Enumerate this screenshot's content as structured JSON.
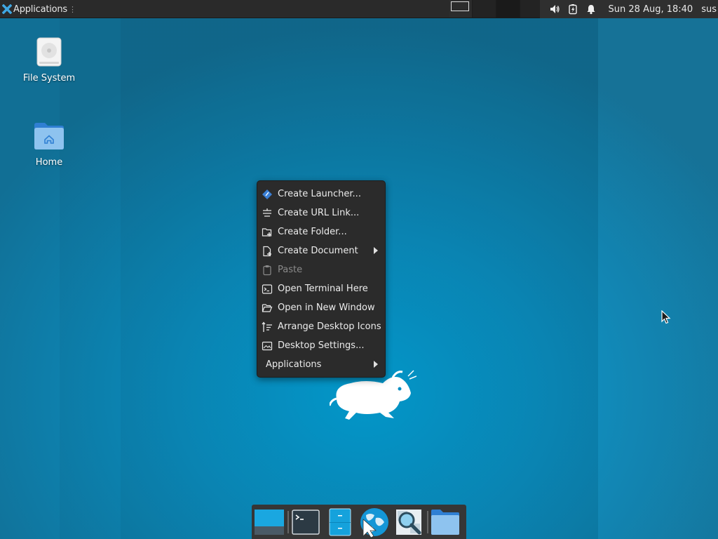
{
  "top_panel": {
    "apps_label": "Applications",
    "apps_separator": "⋮",
    "clock": "Sun 28 Aug, 18:40",
    "user": "sus",
    "workspaces": 4
  },
  "desktop_icons": [
    {
      "label": "File System",
      "icon": "drive-icon"
    },
    {
      "label": "Home",
      "icon": "home-folder-icon"
    }
  ],
  "context_menu": {
    "items": [
      {
        "label": "Create Launcher...",
        "icon": "launcher-icon",
        "enabled": true,
        "submenu": false
      },
      {
        "label": "Create URL Link...",
        "icon": "url-link-icon",
        "enabled": true,
        "submenu": false
      },
      {
        "label": "Create Folder...",
        "icon": "new-folder-icon",
        "enabled": true,
        "submenu": false
      },
      {
        "label": "Create Document",
        "icon": "new-document-icon",
        "enabled": true,
        "submenu": true
      },
      {
        "label": "Paste",
        "icon": "paste-icon",
        "enabled": false,
        "submenu": false
      },
      {
        "label": "Open Terminal Here",
        "icon": "terminal-icon",
        "enabled": true,
        "submenu": false
      },
      {
        "label": "Open in New Window",
        "icon": "open-folder-icon",
        "enabled": true,
        "submenu": false
      },
      {
        "label": "Arrange Desktop Icons",
        "icon": "arrange-icon",
        "enabled": true,
        "submenu": false
      },
      {
        "label": "Desktop Settings...",
        "icon": "desktop-settings-icon",
        "enabled": true,
        "submenu": false
      },
      {
        "label": "Applications",
        "icon": "",
        "enabled": true,
        "submenu": true
      }
    ]
  },
  "dock": {
    "items": [
      {
        "name": "show-desktop",
        "icon": "show-desktop-icon"
      },
      {
        "name": "terminal",
        "icon": "terminal-icon"
      },
      {
        "name": "file-manager",
        "icon": "file-manager-icon"
      },
      {
        "name": "web-browser",
        "icon": "web-browser-icon"
      },
      {
        "name": "app-finder",
        "icon": "app-finder-icon"
      },
      {
        "name": "home-folder",
        "icon": "folder-icon"
      }
    ]
  },
  "colors": {
    "panel": "#2a2a2a",
    "menu_bg": "#2b2b2b",
    "accent": "#3a7fd5",
    "desktop": "#0b8ec0"
  }
}
